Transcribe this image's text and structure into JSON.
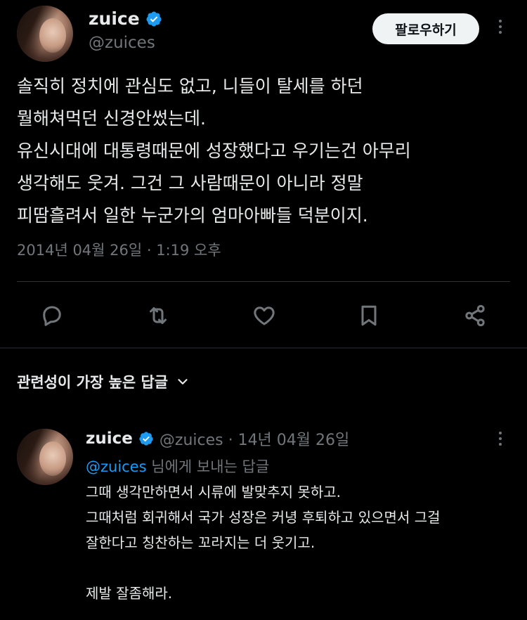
{
  "tweet": {
    "display_name": "zuice",
    "handle": "@zuices",
    "follow_label": "팔로우하기",
    "lines": [
      "솔직히 정치에 관심도 없고, 니들이 탈세를 하던",
      "뭘해쳐먹던 신경안썼는데.",
      "유신시대에 대통령때문에 성장했다고 우기는건 아무리",
      "생각해도 웃겨. 그건 그 사람때문이 아니라 정말",
      "피땀흘려서 일한 누군가의 엄마아빠들 덕분이지."
    ],
    "timestamp": "2014년 04월 26일 · 1:19 오후"
  },
  "actions": {
    "icons": [
      "reply-icon",
      "retweet-icon",
      "like-icon",
      "bookmark-icon",
      "share-icon"
    ]
  },
  "replies_section": {
    "title": "관련성이 가장 높은 답글"
  },
  "reply": {
    "display_name": "zuice",
    "meta": "@zuices · 14년 04월 26일",
    "reply_to_mention": "@zuices",
    "reply_to_suffix": " 님에게 보내는 답글",
    "lines": [
      "그때 생각만하면서 시류에 발맞추지 못하고.",
      "그때처럼 회귀해서 국가 성장은 커녕 후퇴하고 있으면서 그걸",
      "잘한다고 칭찬하는 꼬라지는 더 웃기고.",
      "",
      "제발 잘좀해라."
    ]
  },
  "colors": {
    "background": "#000000",
    "text": "#e7e9ea",
    "muted": "#71767b",
    "accent": "#1d9bf0",
    "follow_bg": "#eff3f4"
  }
}
